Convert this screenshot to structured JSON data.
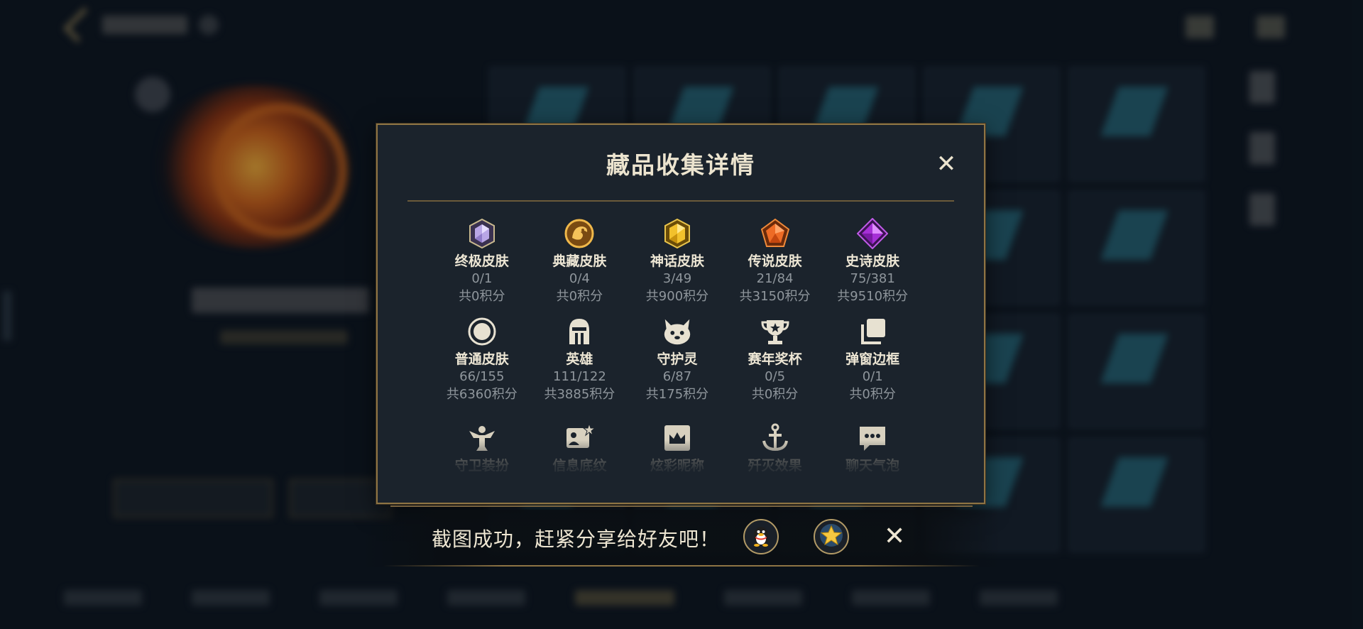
{
  "modal": {
    "title": "藏品收集详情",
    "close_label": "✕",
    "categories": [
      {
        "name": "终极皮肤",
        "count": "0/1",
        "points": "共0积分",
        "icon": "ultimate-skin-gem-icon"
      },
      {
        "name": "典藏皮肤",
        "count": "0/4",
        "points": "共0积分",
        "icon": "collector-skin-dragon-icon"
      },
      {
        "name": "神话皮肤",
        "count": "3/49",
        "points": "共900积分",
        "icon": "mythic-skin-gem-icon"
      },
      {
        "name": "传说皮肤",
        "count": "21/84",
        "points": "共3150积分",
        "icon": "legend-skin-gem-icon"
      },
      {
        "name": "史诗皮肤",
        "count": "75/381",
        "points": "共9510积分",
        "icon": "epic-skin-gem-icon"
      },
      {
        "name": "普通皮肤",
        "count": "66/155",
        "points": "共6360积分",
        "icon": "normal-skin-ring-icon"
      },
      {
        "name": "英雄",
        "count": "111/122",
        "points": "共3885积分",
        "icon": "hero-helmet-icon"
      },
      {
        "name": "守护灵",
        "count": "6/87",
        "points": "共175积分",
        "icon": "guardian-spirit-icon"
      },
      {
        "name": "赛年奖杯",
        "count": "0/5",
        "points": "共0积分",
        "icon": "trophy-icon"
      },
      {
        "name": "弹窗边框",
        "count": "0/1",
        "points": "共0积分",
        "icon": "popup-frame-icon"
      }
    ],
    "partial_categories": [
      {
        "name": "守卫装扮",
        "icon": "guard-outfit-icon"
      },
      {
        "name": "信息底纹",
        "icon": "info-background-icon"
      },
      {
        "name": "炫彩昵称",
        "icon": "colorful-nickname-icon"
      },
      {
        "name": "歼灭效果",
        "icon": "elimination-effect-icon"
      },
      {
        "name": "聊天气泡",
        "icon": "chat-bubble-icon"
      }
    ]
  },
  "toast": {
    "message": "截图成功，赶紧分享给好友吧！",
    "close_label": "✕",
    "share_targets": [
      "qq-penguin-icon",
      "star-favorite-icon"
    ]
  },
  "colors": {
    "modal_bg": "#1b232c",
    "gold_border": "#8e7444",
    "text_light": "#ede6d4",
    "text_muted": "#8f969c"
  }
}
